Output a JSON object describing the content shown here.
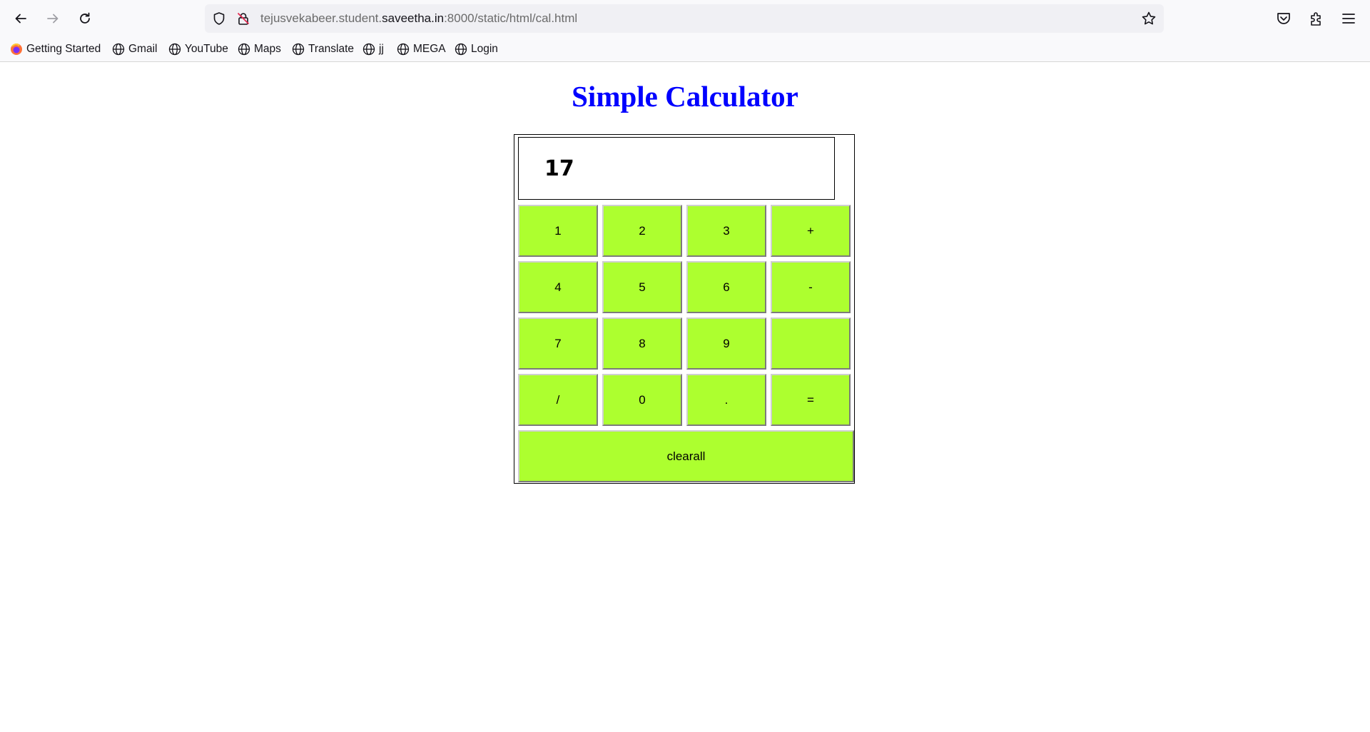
{
  "browser": {
    "url_prefix": "tejusvekabeer.student.",
    "url_domain": "saveetha.in",
    "url_suffix": ":8000/static/html/cal.html",
    "bookmarks": [
      "Getting Started",
      "Gmail",
      "YouTube",
      "Maps",
      "Translate",
      "jj",
      "MEGA",
      "Login"
    ]
  },
  "page": {
    "title": "Simple Calculator",
    "display_value": "17",
    "keys": [
      "1",
      "2",
      "3",
      "+",
      "4",
      "5",
      "6",
      "-",
      "7",
      "8",
      "9",
      "",
      "/",
      "0",
      ".",
      "="
    ],
    "clear_label": "clearall"
  },
  "colors": {
    "title": "#0000ff",
    "key_background": "#adff2f"
  }
}
